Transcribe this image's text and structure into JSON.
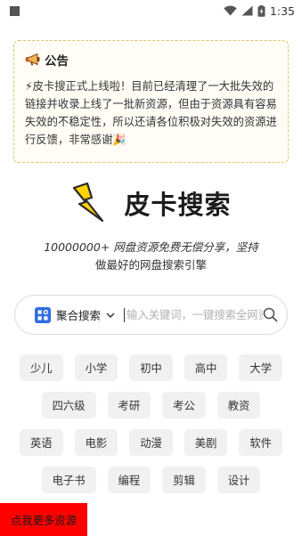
{
  "status_bar": {
    "time": "1:35"
  },
  "notice": {
    "title": "公告",
    "body": "⚡皮卡搜正式上线啦！目前已经清理了一大批失效的链接并收录上线了一批新资源，但由于资源具有容易失效的不稳定性，所以还请各位积极对失效的资源进行反馈，非常感谢🎉"
  },
  "brand": {
    "name": "皮卡搜索",
    "logo_icon": "lightning-bolt-icon",
    "logo_color": "#ffd200"
  },
  "slogan": {
    "line1": "10000000+ 网盘资源免费无偿分享，坚持",
    "line2": "做最好的网盘搜索引擎"
  },
  "search": {
    "engine_label": "聚合搜索",
    "placeholder": "输入关键词，一键搜索全网资源",
    "engine_icon_color": "#2f6de1"
  },
  "tags": [
    [
      "少儿",
      "小学",
      "初中",
      "高中",
      "大学"
    ],
    [
      "四六级",
      "考研",
      "考公",
      "教资"
    ],
    [
      "英语",
      "电影",
      "动漫",
      "美剧",
      "软件"
    ],
    [
      "电子书",
      "编程",
      "剪辑",
      "设计"
    ]
  ],
  "more_button": {
    "label": "点我更多资源",
    "color": "#ff0000"
  }
}
